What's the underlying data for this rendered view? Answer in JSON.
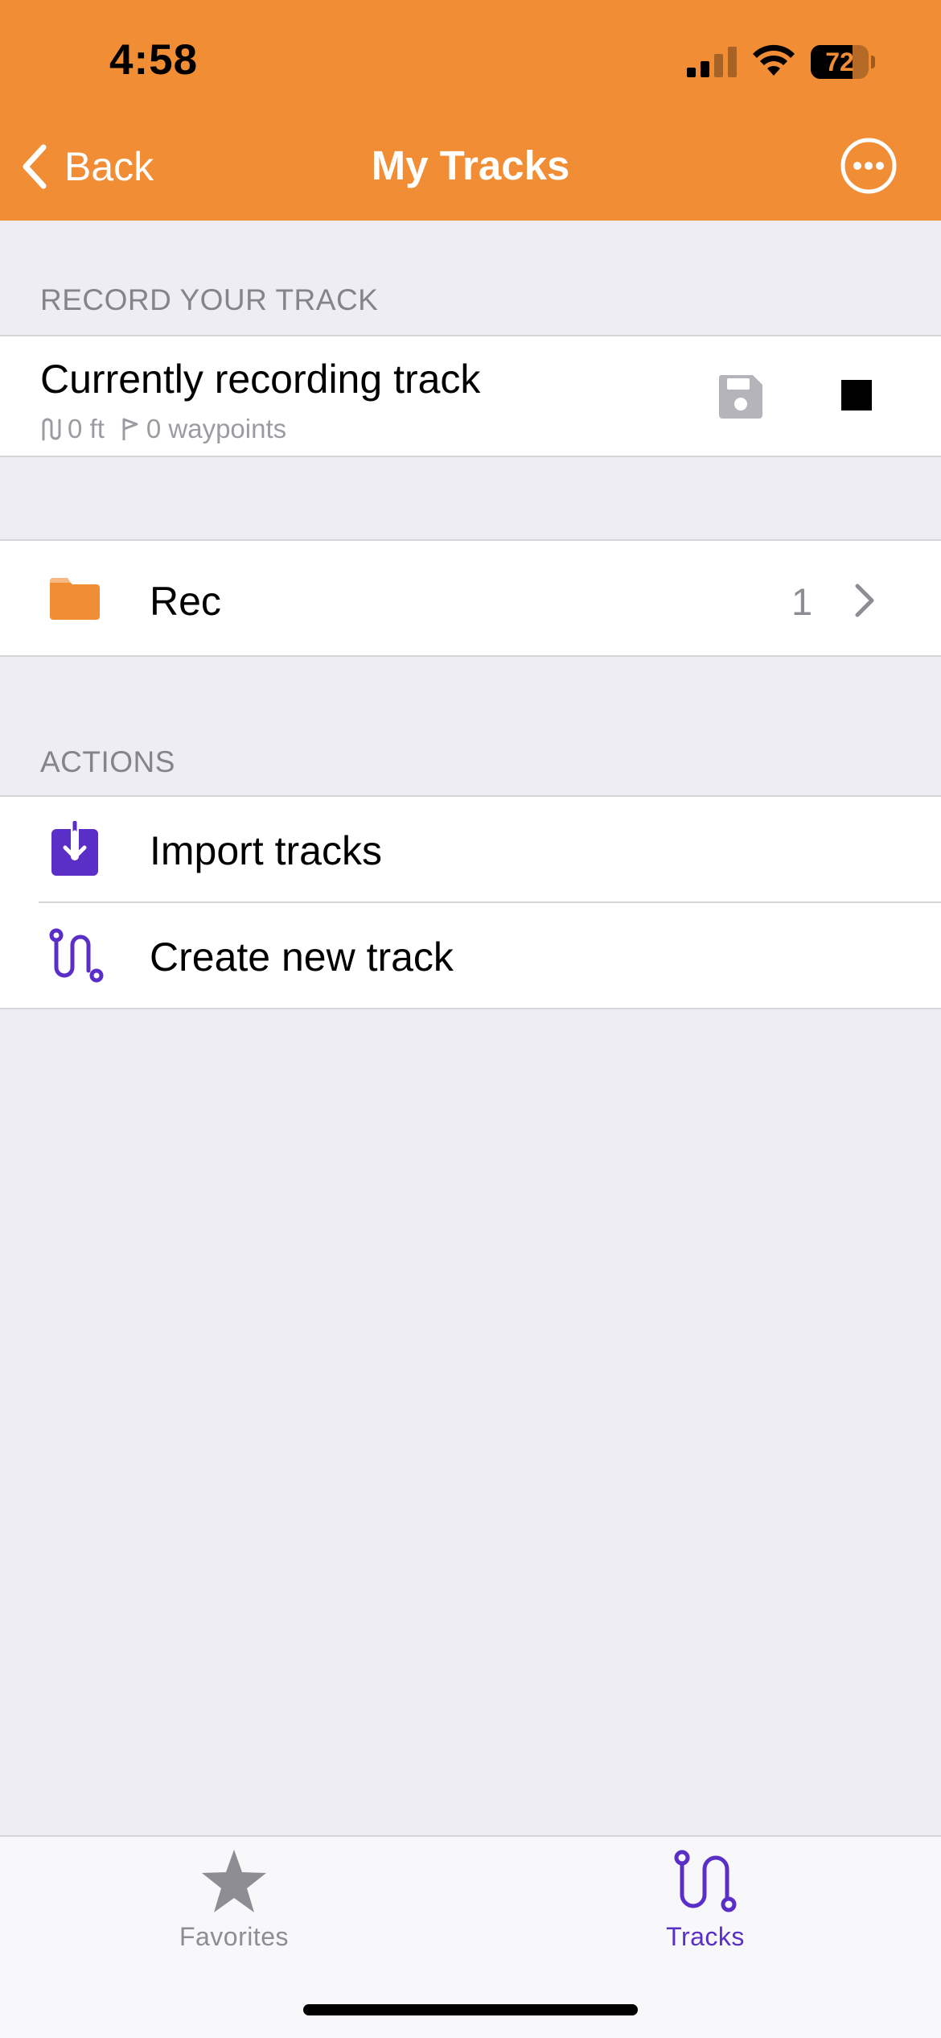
{
  "status_bar": {
    "time": "4:58",
    "battery": "72",
    "battery_level": 0.72
  },
  "nav": {
    "back_label": "Back",
    "title": "My Tracks"
  },
  "record_section": {
    "header": "RECORD YOUR TRACK",
    "track_title": "Currently recording track",
    "distance": "0 ft",
    "waypoints": "0 waypoints"
  },
  "folder": {
    "name": "Rec",
    "count": "1"
  },
  "actions_section": {
    "header": "ACTIONS",
    "items": [
      {
        "label": "Import tracks",
        "icon": "import-icon"
      },
      {
        "label": "Create new track",
        "icon": "route-icon"
      }
    ]
  },
  "tabbar": {
    "tabs": [
      {
        "label": "Favorites",
        "icon": "star-icon",
        "active": false
      },
      {
        "label": "Tracks",
        "icon": "route-icon",
        "active": true
      }
    ]
  },
  "colors": {
    "header": "#F08D35",
    "accent": "#5A2FC7",
    "background": "#EEEDF3",
    "folder": "#F08D35"
  }
}
